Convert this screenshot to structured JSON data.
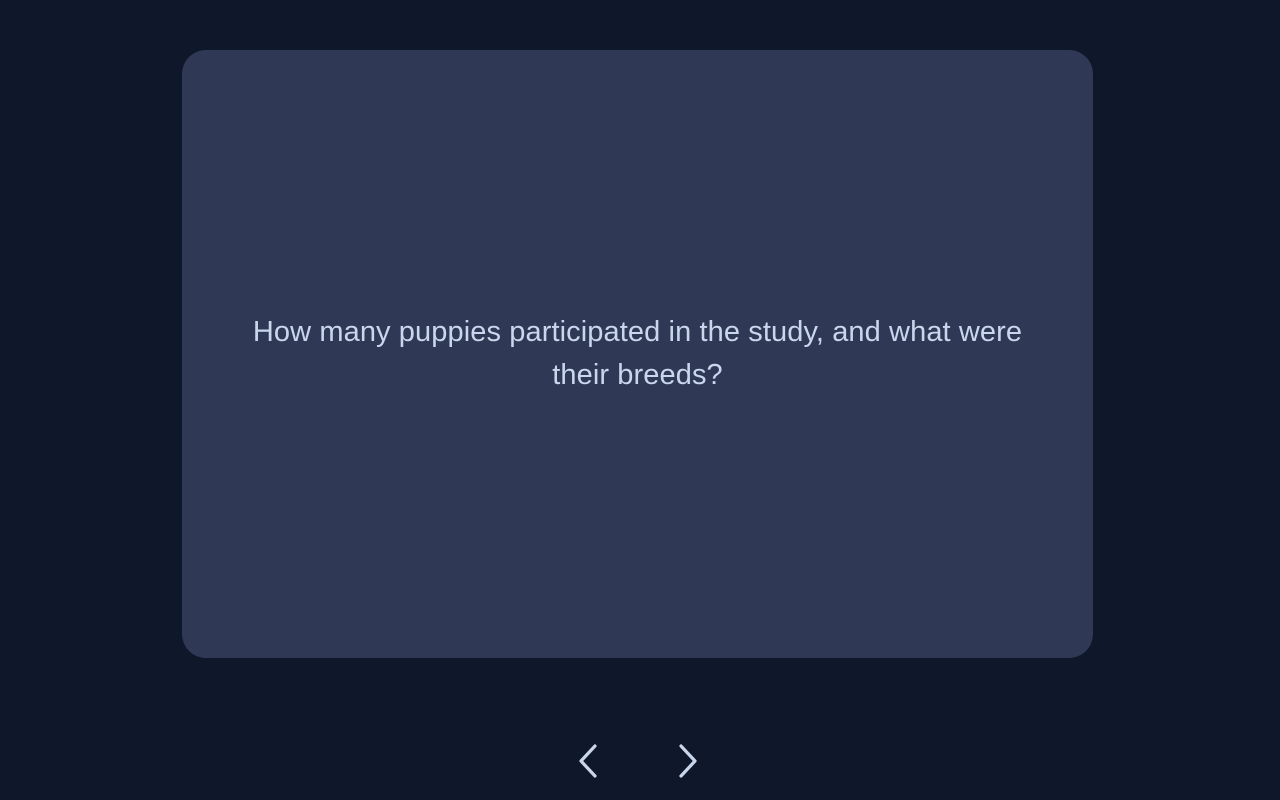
{
  "card": {
    "text": "How many puppies participated in the study, and what were their breeds?"
  },
  "navigation": {
    "prev_icon": "chevron-left-icon",
    "next_icon": "chevron-right-icon"
  },
  "colors": {
    "background": "#0f172a",
    "card": "#2f3854",
    "text": "#c9d6ec",
    "icon": "#c9d6ec"
  }
}
